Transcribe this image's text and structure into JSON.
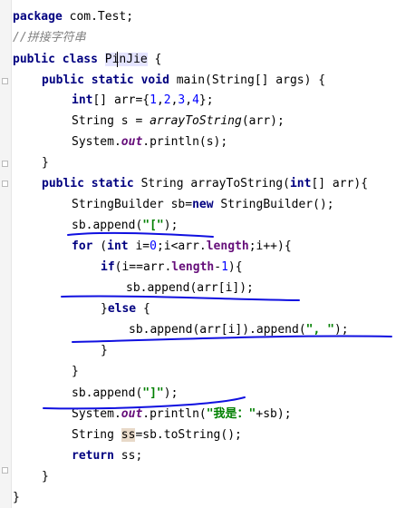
{
  "code": {
    "l1": {
      "kw": "package",
      "rest": " com.Test;"
    },
    "l2": {
      "comment": "//拼接字符串"
    },
    "l3": {
      "kw1": "public",
      "kw2": "class",
      "cls": "PinJie",
      "rest": " {"
    },
    "l4": {
      "kw1": "public",
      "kw2": "static",
      "kw3": "void",
      "rest": " main(String[] args) {"
    },
    "l5": {
      "kw": "int",
      "p1": "[] arr={",
      "n1": "1",
      "c1": ",",
      "n2": "2",
      "c2": ",",
      "n3": "3",
      "c3": ",",
      "n4": "4",
      "p2": "};"
    },
    "l6": {
      "p1": "String s = ",
      "call": "arrayToString",
      "p2": "(arr);"
    },
    "l7": {
      "p1": "System.",
      "fld": "out",
      "p2": ".println(s);"
    },
    "l8": {
      "text": "}"
    },
    "l9": {
      "kw1": "public",
      "kw2": "static",
      "p1": " String arrayToString(",
      "kw3": "int",
      "p2": "[] arr){"
    },
    "l10": {
      "p1": "StringBuilder sb=",
      "kw": "new",
      "p2": " StringBuilder();"
    },
    "l11": {
      "p1": "sb.append(",
      "str": "\"[\"",
      "p2": ");"
    },
    "l12": {
      "kw1": "for",
      "p1": " (",
      "kw2": "int",
      "p2": " i=",
      "n1": "0",
      "p3": ";i<arr.",
      "fld": "length",
      "p4": ";i++){"
    },
    "l13": {
      "kw": "if",
      "p1": "(i==arr.",
      "fld": "length",
      "p2": "-",
      "n1": "1",
      "p3": "){"
    },
    "l14": {
      "text": "sb.append(arr[i]);"
    },
    "l15": {
      "p1": "}",
      "kw": "else",
      "p2": " {"
    },
    "l16": {
      "p1": "sb.append(arr[i]).append(",
      "str": "\", \"",
      "p2": ");"
    },
    "l17": {
      "text": "}"
    },
    "l18": {
      "text": "}"
    },
    "l19": {
      "p1": "sb.append(",
      "str": "\"]\"",
      "p2": ");"
    },
    "l20": {
      "p1": "System.",
      "fld": "out",
      "p2": ".println(",
      "str": "\"我是：\"",
      "p3": "+sb);"
    },
    "l21": {
      "p1": "String ",
      "var": "ss",
      "p2": "=sb.toString();"
    },
    "l22": {
      "kw": "return",
      "p1": " ss;"
    },
    "l23": {
      "text": "}"
    },
    "l24": {
      "text": "}"
    }
  },
  "colors": {
    "keyword": "#000080",
    "comment": "#808080",
    "string": "#008000",
    "number": "#0000ff",
    "field": "#660e7a",
    "annotation": "#1010e0"
  }
}
